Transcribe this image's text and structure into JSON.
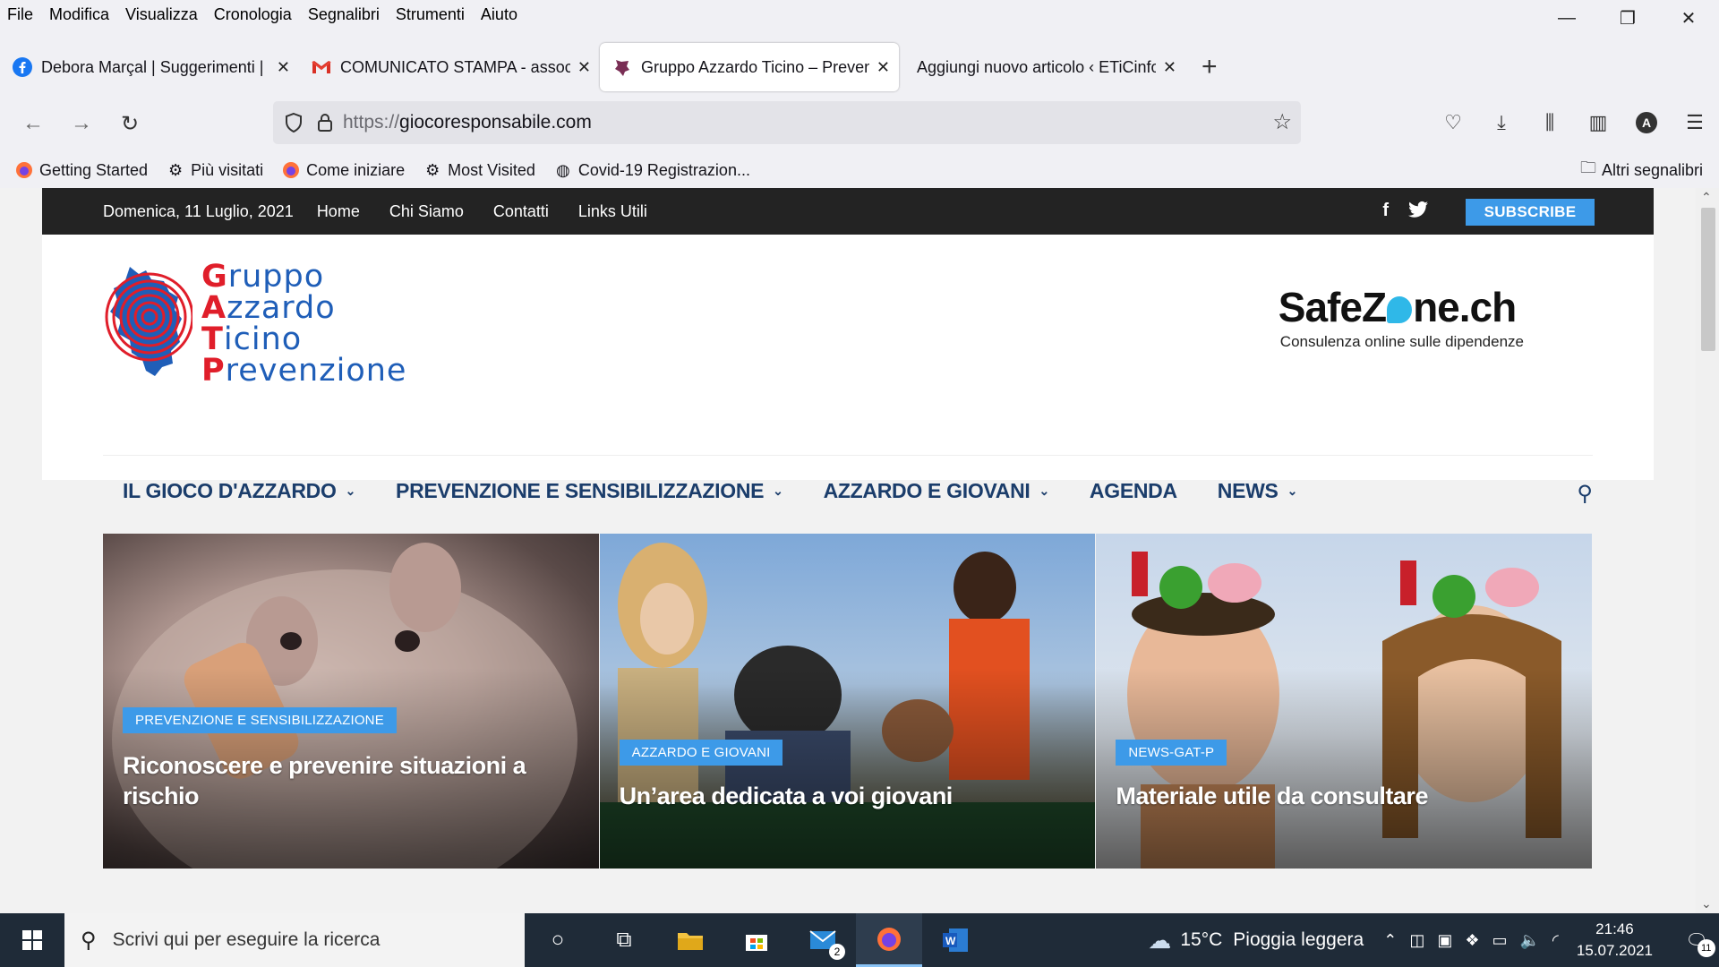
{
  "menubar": {
    "items": [
      "File",
      "Modifica",
      "Visualizza",
      "Cronologia",
      "Segnalibri",
      "Strumenti",
      "Aiuto"
    ]
  },
  "window_controls": {
    "minimize": "—",
    "restore": "❐",
    "close": "✕"
  },
  "tabs": [
    {
      "title": "Debora Marçal | Suggerimenti |",
      "icon": "facebook-icon",
      "active": false
    },
    {
      "title": "COMUNICATO STAMPA - associ",
      "icon": "gmail-icon",
      "active": false
    },
    {
      "title": "Gruppo Azzardo Ticino – Preven",
      "icon": "site-icon",
      "active": true
    },
    {
      "title": "Aggiungi nuovo articolo ‹ ETiCinform",
      "icon": "",
      "active": false
    }
  ],
  "navbar": {
    "url_prefix": "https://",
    "url_host": "giocoresponsabile.com"
  },
  "bookmarks": {
    "items": [
      {
        "label": "Getting Started",
        "icon": "firefox-icon"
      },
      {
        "label": "Più visitati",
        "icon": "gear-icon"
      },
      {
        "label": "Come iniziare",
        "icon": "firefox-icon"
      },
      {
        "label": "Most Visited",
        "icon": "gear-icon"
      },
      {
        "label": "Covid-19 Registrazion...",
        "icon": "globe-icon"
      }
    ],
    "other": "Altri segnalibri"
  },
  "site": {
    "topbar": {
      "date": "Domenica, 11 Luglio, 2021",
      "links": [
        "Home",
        "Chi Siamo",
        "Contatti",
        "Links Utili"
      ],
      "subscribe": "SUBSCRIBE"
    },
    "logo": {
      "line1_first": "G",
      "line1_rest": "ruppo",
      "line2_first": "A",
      "line2_rest": "zzardo",
      "line3_first": "T",
      "line3_rest": "icino",
      "line4_first": "P",
      "line4_rest": "revenzione"
    },
    "safezone": {
      "name_a": "SafeZ",
      "name_b": "ne.ch",
      "tagline": "Consulenza online sulle dipendenze"
    },
    "nav": [
      {
        "label": "IL GIOCO D'AZZARDO",
        "dropdown": true
      },
      {
        "label": "PREVENZIONE E SENSIBILIZZAZIONE",
        "dropdown": true
      },
      {
        "label": "AZZARDO E GIOVANI",
        "dropdown": true
      },
      {
        "label": "AGENDA",
        "dropdown": false
      },
      {
        "label": "NEWS",
        "dropdown": true
      }
    ],
    "hero": [
      {
        "badge": "PREVENZIONE E SENSIBILIZZAZIONE",
        "title": "Riconoscere e prevenire situazioni a rischio"
      },
      {
        "badge": "AZZARDO E GIOVANI",
        "title": "Un’area dedicata a voi giovani"
      },
      {
        "badge": "NEWS-GAT-P",
        "title": "Materiale utile da consultare"
      }
    ]
  },
  "taskbar": {
    "search_placeholder": "Scrivi qui per eseguire la ricerca",
    "weather_temp": "15°C",
    "weather_desc": "Pioggia leggera",
    "time": "21:46",
    "date": "15.07.2021",
    "mail_badge": "2",
    "notif_badge": "11"
  },
  "colors": {
    "accent": "#3d9ae8",
    "nav": "#1b3d6b",
    "topbar": "#232323"
  }
}
